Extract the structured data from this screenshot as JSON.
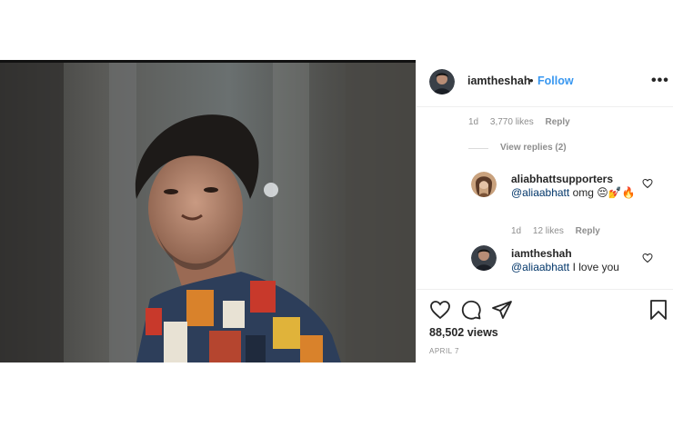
{
  "header": {
    "username": "iamtheshah",
    "separator": "•",
    "follow_label": "Follow",
    "more_label": "•••"
  },
  "top_comment_meta": {
    "age": "1d",
    "likes": "3,770 likes",
    "reply": "Reply"
  },
  "view_replies": "View replies (2)",
  "replies": [
    {
      "username": "aliabhattsupporters",
      "mention": "@aliaabhatt",
      "text": " omg",
      "emoji": "😔💅🔥",
      "age": "1d",
      "likes": "12 likes",
      "reply": "Reply"
    },
    {
      "username": "iamtheshah",
      "mention": "@aliaabhatt",
      "text": " I love you"
    }
  ],
  "footer": {
    "views": "88,502 views",
    "date": "APRIL 7"
  },
  "icons": [
    "heart-icon",
    "comment-icon",
    "share-icon",
    "bookmark-icon",
    "more-icon"
  ],
  "colors": {
    "accent": "#3897f0",
    "muted": "#8e8e8e",
    "text": "#262626"
  }
}
